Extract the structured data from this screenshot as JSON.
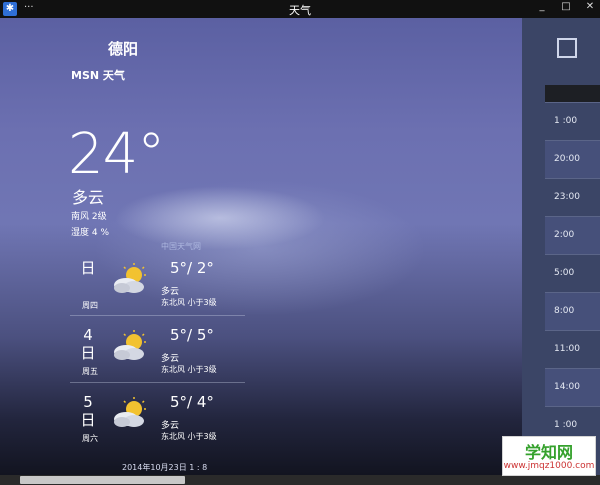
{
  "window": {
    "title": "天气",
    "menu_dots": "···",
    "controls": [
      "_",
      "□",
      "✕"
    ]
  },
  "header": {
    "city": "德阳",
    "source": "MSN 天气"
  },
  "current": {
    "temp": "24°",
    "condition": "多云",
    "wind": "南风 2级",
    "humidity": "湿度 4 %",
    "provider": "中国天气网"
  },
  "forecast": [
    {
      "date": "",
      "day_char": "日",
      "weekday": "周四",
      "icon": "partly-cloudy-icon",
      "temps": "5°/ 2°",
      "condition": "多云",
      "wind": "东北风 小于3级"
    },
    {
      "date": "4",
      "day_char": "日",
      "weekday": "周五",
      "icon": "partly-cloudy-icon",
      "temps": "5°/ 5°",
      "condition": "多云",
      "wind": "东北风 小于3级"
    },
    {
      "date": "5",
      "day_char": "日",
      "weekday": "周六",
      "icon": "partly-cloudy-icon",
      "temps": "5°/ 4°",
      "condition": "多云",
      "wind": "东北风 小于3级"
    }
  ],
  "updated": "2014年10月23日 1 : 8",
  "sidebar": {
    "times": [
      "1 :00",
      "20:00",
      "23:00",
      "2:00",
      "5:00",
      "8:00",
      "11:00",
      "14:00",
      "1 :00"
    ]
  },
  "watermark": {
    "top": "学知网",
    "bottom": "www.jmqz1000.com"
  },
  "colors": {
    "sky_top": "#5b60a2",
    "sky_bottom": "#121420",
    "sidebar": "#3b4566",
    "watermark_green": "#35a12c"
  }
}
